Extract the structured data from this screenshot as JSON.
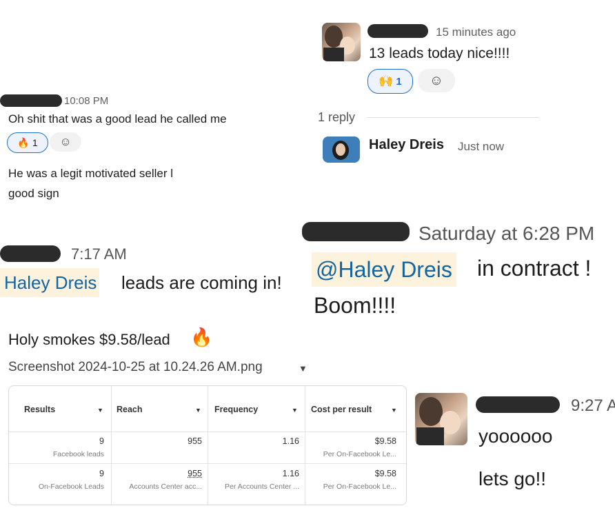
{
  "top_right": {
    "timestamp": "15 minutes ago",
    "message": "13 leads today nice!!!!",
    "reaction": {
      "emoji": "🙌",
      "count": "1"
    },
    "replies": "1 reply",
    "reply_author": "Haley Dreis",
    "reply_time": "Just now"
  },
  "top_left": {
    "timestamp": "10:08 PM",
    "message": "Oh shit that was a good lead he called me",
    "reaction": {
      "emoji": "🔥",
      "count": "1"
    },
    "message2_line1": "He was a legit motivated seller l",
    "message2_line2": "good sign"
  },
  "mid_left": {
    "timestamp": "7:17 AM",
    "mention": "Haley Dreis",
    "message": "leads are coming in!",
    "message2": "Holy smokes $9.58/lead",
    "message2_emoji": "🔥",
    "attachment": "Screenshot 2024-10-25 at 10.24.26 AM.png",
    "attachment_caret": "▼"
  },
  "mid_right": {
    "timestamp": "Saturday at 6:28 PM",
    "mention": "@Haley Dreis",
    "message": "in contract !",
    "message2": "Boom!!!!"
  },
  "bottom_right": {
    "timestamp": "9:27 A",
    "message": "yoooooo",
    "message2": "lets go!!"
  },
  "table": {
    "headers": [
      "Results",
      "Reach",
      "Frequency",
      "Cost per result"
    ],
    "caret": "▼",
    "rows": [
      {
        "results": "9",
        "results_sub": "Facebook leads",
        "reach": "955",
        "reach_sub": "",
        "frequency": "1.16",
        "frequency_sub": "",
        "cost": "$9.58",
        "cost_sub": "Per On-Facebook Le..."
      },
      {
        "results": "9",
        "results_sub": "On-Facebook Leads",
        "reach": "955",
        "reach_sub": "Accounts Center acc...",
        "frequency": "1.16",
        "frequency_sub": "Per Accounts Center ...",
        "cost": "$9.58",
        "cost_sub": "Per On-Facebook Le..."
      }
    ]
  },
  "colors": {
    "mention_bg": "#fdf3dd",
    "mention_text": "#1264a3",
    "reaction_border": "#1d6fd1"
  }
}
